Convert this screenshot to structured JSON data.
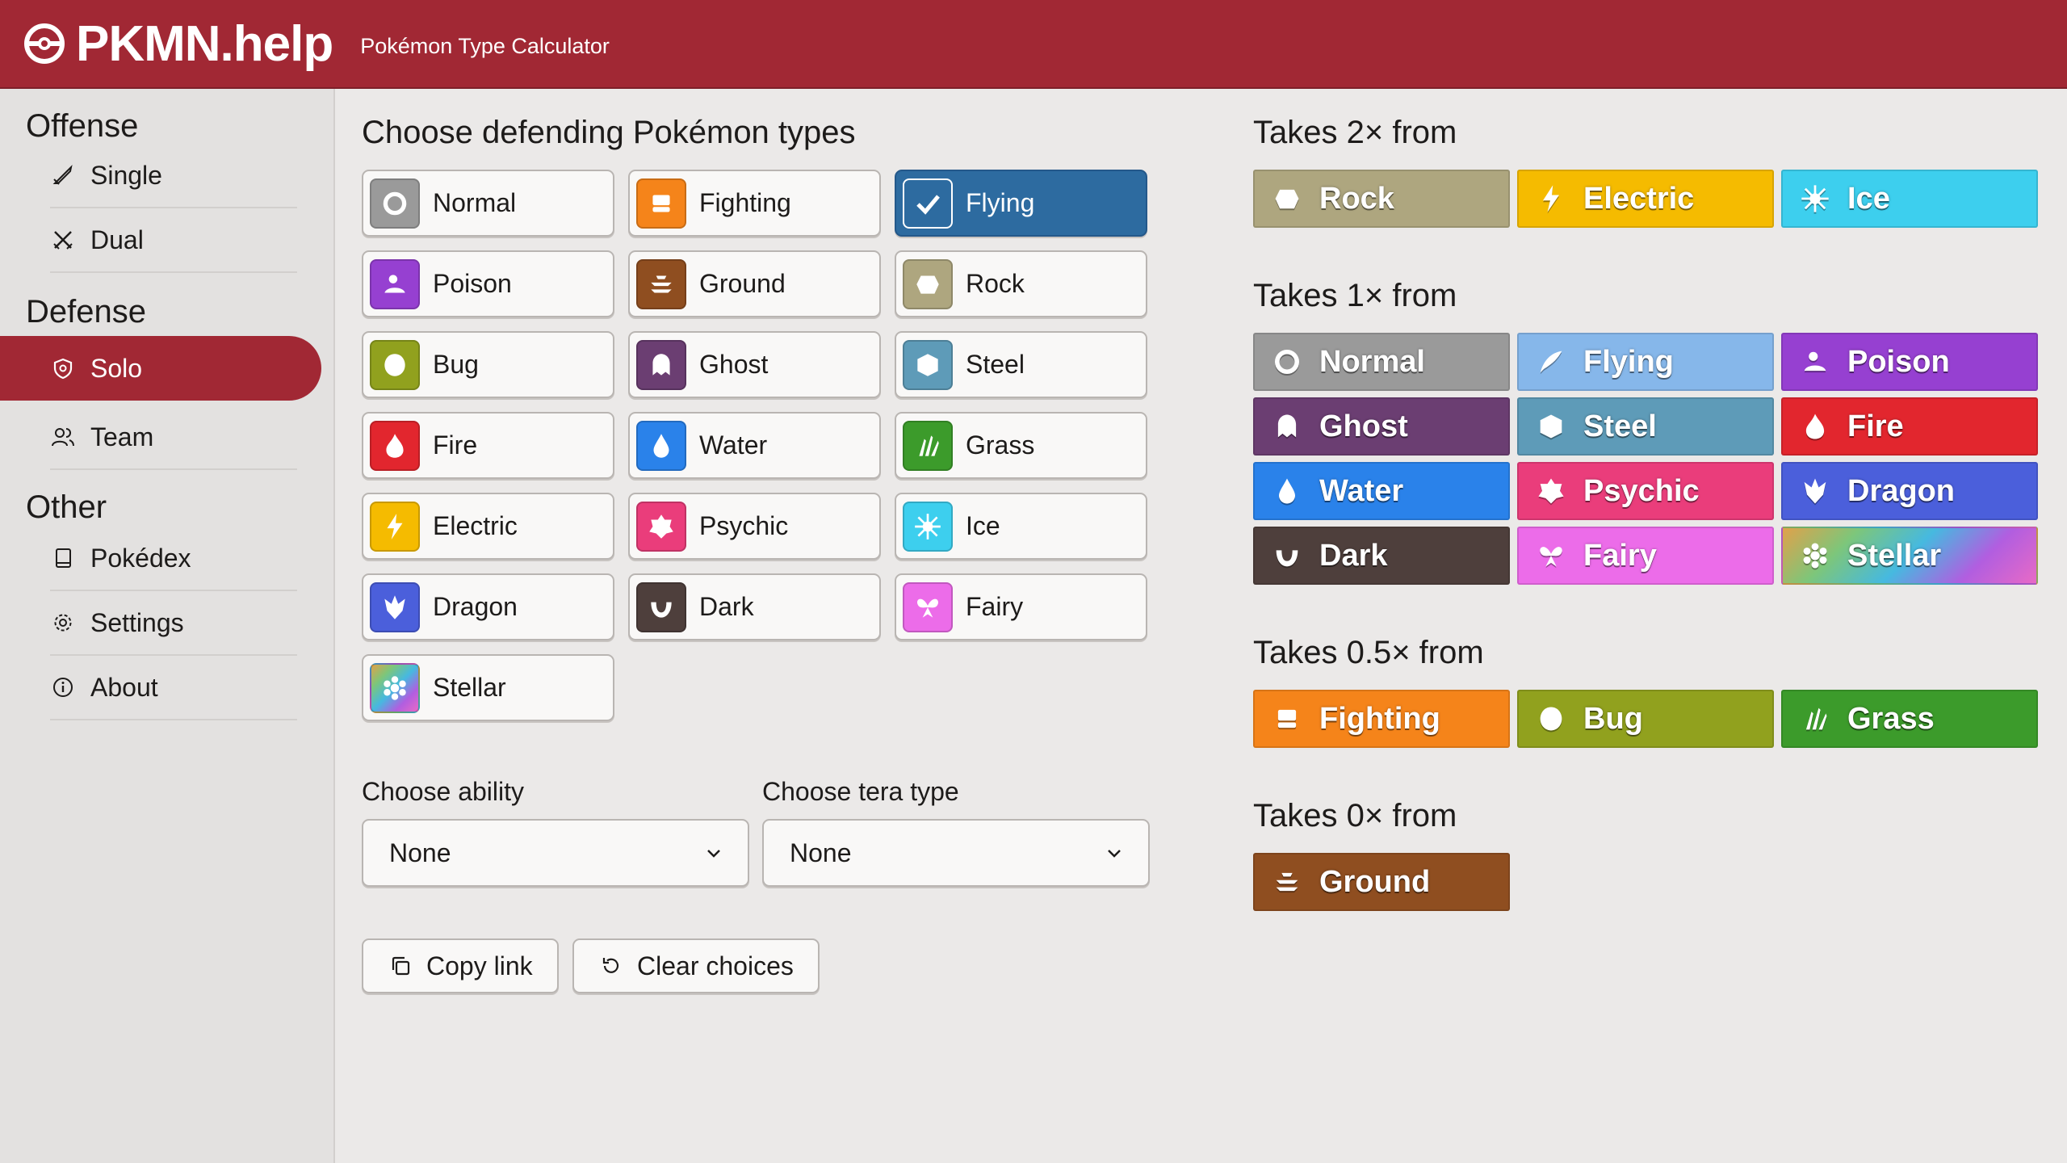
{
  "header": {
    "brand": "PKMN.help",
    "subtitle": "Pokémon Type Calculator",
    "bg_color": "#a12834"
  },
  "sidebar": {
    "sections": [
      {
        "title": "Offense",
        "items": [
          {
            "label": "Single",
            "icon": "sword-icon",
            "active": false
          },
          {
            "label": "Dual",
            "icon": "crossed-swords-icon",
            "active": false
          }
        ]
      },
      {
        "title": "Defense",
        "items": [
          {
            "label": "Solo",
            "icon": "shield-icon",
            "active": true
          },
          {
            "label": "Team",
            "icon": "users-icon",
            "active": false
          }
        ]
      },
      {
        "title": "Other",
        "items": [
          {
            "label": "Pokédex",
            "icon": "book-icon",
            "active": false
          },
          {
            "label": "Settings",
            "icon": "gear-icon",
            "active": false
          },
          {
            "label": "About",
            "icon": "info-icon",
            "active": false
          }
        ]
      }
    ]
  },
  "main": {
    "title": "Choose defending Pokémon types",
    "types": [
      {
        "label": "Normal",
        "color": "#9a9a9a",
        "selected": false
      },
      {
        "label": "Fighting",
        "color": "#f5841a",
        "selected": false
      },
      {
        "label": "Flying",
        "color": "#7fb5e8",
        "selected": true
      },
      {
        "label": "Poison",
        "color": "#9640d1",
        "selected": false
      },
      {
        "label": "Ground",
        "color": "#8f4e20",
        "selected": false
      },
      {
        "label": "Rock",
        "color": "#aea67f",
        "selected": false
      },
      {
        "label": "Bug",
        "color": "#91a11e",
        "selected": false
      },
      {
        "label": "Ghost",
        "color": "#6b3e72",
        "selected": false
      },
      {
        "label": "Steel",
        "color": "#5e9bb8",
        "selected": false
      },
      {
        "label": "Fire",
        "color": "#e2262e",
        "selected": false
      },
      {
        "label": "Water",
        "color": "#2a82ea",
        "selected": false
      },
      {
        "label": "Grass",
        "color": "#3c9b2b",
        "selected": false
      },
      {
        "label": "Electric",
        "color": "#f5bb00",
        "selected": false
      },
      {
        "label": "Psychic",
        "color": "#ea3d7b",
        "selected": false
      },
      {
        "label": "Ice",
        "color": "#3dcfee",
        "selected": false
      },
      {
        "label": "Dragon",
        "color": "#4b5fdb",
        "selected": false
      },
      {
        "label": "Dark",
        "color": "#4e3f3c",
        "selected": false
      },
      {
        "label": "Fairy",
        "color": "#ec6ce9",
        "selected": false
      },
      {
        "label": "Stellar",
        "color": "#6fbfae",
        "selected": false
      }
    ],
    "ability_label": "Choose ability",
    "ability_value": "None",
    "tera_label": "Choose tera type",
    "tera_value": "None",
    "copy_label": "Copy link",
    "clear_label": "Clear choices"
  },
  "results": {
    "groups": [
      {
        "title": "Takes 2× from",
        "types": [
          {
            "label": "Rock",
            "color": "#aea67f"
          },
          {
            "label": "Electric",
            "color": "#f5bb00"
          },
          {
            "label": "Ice",
            "color": "#3dcfee"
          }
        ]
      },
      {
        "title": "Takes 1× from",
        "types": [
          {
            "label": "Normal",
            "color": "#9a9a9a"
          },
          {
            "label": "Flying",
            "color": "#86b7ea"
          },
          {
            "label": "Poison",
            "color": "#9640d1"
          },
          {
            "label": "Ghost",
            "color": "#6b3e72"
          },
          {
            "label": "Steel",
            "color": "#5e9bb8"
          },
          {
            "label": "Fire",
            "color": "#e2262e"
          },
          {
            "label": "Water",
            "color": "#2a82ea"
          },
          {
            "label": "Psychic",
            "color": "#ea3d7b"
          },
          {
            "label": "Dragon",
            "color": "#4b5fdb"
          },
          {
            "label": "Dark",
            "color": "#4e3f3c"
          },
          {
            "label": "Fairy",
            "color": "#ec6ce9"
          },
          {
            "label": "Stellar",
            "color": "#6fbfae"
          }
        ]
      },
      {
        "title": "Takes 0.5× from",
        "types": [
          {
            "label": "Fighting",
            "color": "#f5841a"
          },
          {
            "label": "Bug",
            "color": "#91a11e"
          },
          {
            "label": "Grass",
            "color": "#3c9b2b"
          }
        ]
      },
      {
        "title": "Takes 0× from",
        "types": [
          {
            "label": "Ground",
            "color": "#8f4e20"
          }
        ]
      }
    ]
  }
}
